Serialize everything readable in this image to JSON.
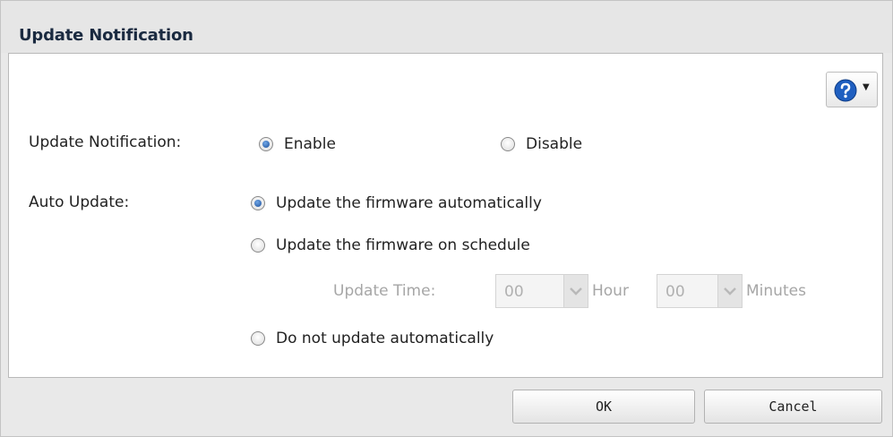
{
  "dialog": {
    "title": "Update Notification",
    "help_icon": "help-question-icon"
  },
  "notification": {
    "label": "Update Notification:",
    "options": [
      {
        "label": "Enable",
        "selected": true
      },
      {
        "label": "Disable",
        "selected": false
      }
    ]
  },
  "auto_update": {
    "label": "Auto Update:",
    "options": [
      {
        "label": "Update the firmware automatically",
        "selected": true
      },
      {
        "label": "Update the firmware on schedule",
        "selected": false
      },
      {
        "label": "Do not update automatically",
        "selected": false
      }
    ],
    "schedule": {
      "label": "Update Time:",
      "hour_value": "00",
      "hour_unit": "Hour",
      "minute_value": "00",
      "minute_unit": "Minutes",
      "enabled": false
    }
  },
  "buttons": {
    "ok": "OK",
    "cancel": "Cancel"
  },
  "colors": {
    "radio_selected": "#1d4f9a",
    "title_text": "#1a2a40",
    "disabled_text": "#a6a6a6"
  }
}
